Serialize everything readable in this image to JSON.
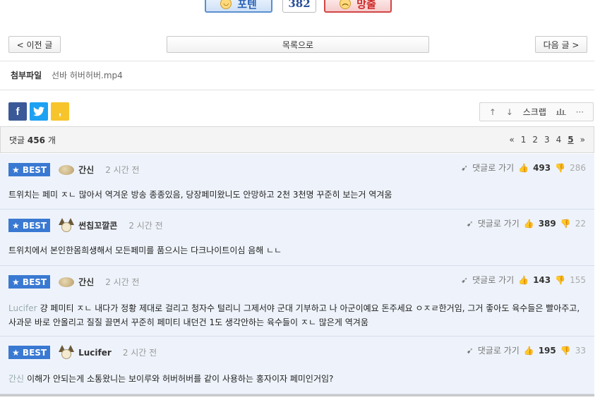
{
  "votes": {
    "up_label": "포텐",
    "count": "382",
    "down_label": "망출"
  },
  "nav": {
    "prev": "< 이전 글",
    "list": "목록으로",
    "next": "다음 글 >"
  },
  "attachment": {
    "label": "첨부파일",
    "file": "선바 허버허버.mp4"
  },
  "share": {
    "facebook": "f",
    "twitter": "t",
    "kakaostory": ","
  },
  "tools": {
    "up_icon": "↑",
    "down_icon": "↓",
    "scrap": "스크랩",
    "chart_icon": "chart-icon",
    "more": "···"
  },
  "comments_header": {
    "label": "댓글",
    "count": "456",
    "unit": "개"
  },
  "pager": {
    "first": "«",
    "pages": [
      "1",
      "2",
      "3",
      "4",
      "5"
    ],
    "current": "5",
    "last": "»"
  },
  "comments": [
    {
      "badge": "★ BEST",
      "nick": "간신",
      "time": "2 시간 전",
      "reply_link": "댓글로 가기",
      "up": "493",
      "down": "286",
      "reply_to": "",
      "text": "트위치는 페미 ㅈㄴ 많아서 역겨운 방송 종종있음, 당장페미왔니도 안망하고 2천 3천명 꾸준히 보는거 역겨움"
    },
    {
      "badge": "★ BEST",
      "nick": "썬칩꼬깔콘",
      "time": "2 시간 전",
      "reply_link": "댓글로 가기",
      "up": "389",
      "down": "22",
      "reply_to": "",
      "text": "트위치에서 본인한몸희생해서 모든페미를 품으시는 다크나이트이심 음해 ㄴㄴ"
    },
    {
      "badge": "★ BEST",
      "nick": "간신",
      "time": "2 시간 전",
      "reply_link": "댓글로 가기",
      "up": "143",
      "down": "155",
      "reply_to": "Lucifer",
      "text": "걍 페미티 ㅈㄴ 내다가 정황 제대로 걸리고 청자수 털리니 그제서야 군대 기부하고 나 아군이예요 돈주세요 ㅇㅈㄹ한거임, 그거 좋아도 육수들은 빨아주고, 사과문 바로 안올리고 질질 끌면서 꾸준히 페미티 내던건 1도 생각안하는 육수들이 ㅈㄴ 많은게 역겨움"
    },
    {
      "badge": "★ BEST",
      "nick": "Lucifer",
      "time": "2 시간 전",
      "reply_link": "댓글로 가기",
      "up": "195",
      "down": "33",
      "reply_to": "간신",
      "text": "이해가 안되는게 소통왔니는 보이루와 허버허버를 같이 사용하는 홍자이자 페미인거임?"
    }
  ]
}
